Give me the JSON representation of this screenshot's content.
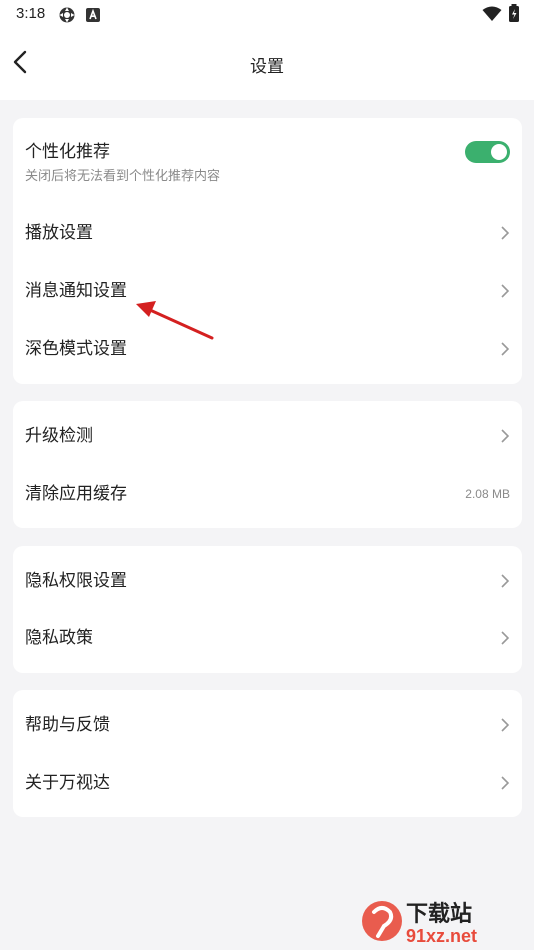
{
  "status_bar": {
    "time": "3:18",
    "icons": [
      "settings-app-icon",
      "a-notification-icon",
      "wifi-icon",
      "battery-icon"
    ]
  },
  "header": {
    "title": "设置",
    "back_icon": "chevron-left-icon"
  },
  "groups": [
    {
      "items": [
        {
          "label": "个性化推荐",
          "sublabel": "关闭后将无法看到个性化推荐内容",
          "type": "toggle",
          "toggle_on": true
        },
        {
          "label": "播放设置",
          "type": "link"
        },
        {
          "label": "消息通知设置",
          "type": "link"
        },
        {
          "label": "深色模式设置",
          "type": "link"
        }
      ]
    },
    {
      "items": [
        {
          "label": "升级检测",
          "type": "link"
        },
        {
          "label": "清除应用缓存",
          "type": "value",
          "value": "2.08 MB"
        }
      ]
    },
    {
      "items": [
        {
          "label": "隐私权限设置",
          "type": "link"
        },
        {
          "label": "隐私政策",
          "type": "link"
        }
      ]
    },
    {
      "items": [
        {
          "label": "帮助与反馈",
          "type": "link"
        },
        {
          "label": "关于万视达",
          "type": "link"
        }
      ]
    }
  ],
  "watermark": {
    "brand": "下载站",
    "url": "91xz.net"
  },
  "colors": {
    "accent_toggle": "#3bb06e",
    "annotation_arrow": "#d42020",
    "background": "#f4f4f6"
  }
}
